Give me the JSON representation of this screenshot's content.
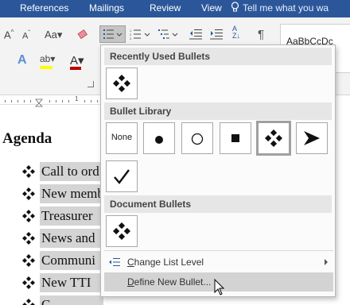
{
  "ribbon_tabs": [
    "References",
    "Mailings",
    "Review",
    "View"
  ],
  "tell_me": "Tell me what you wa",
  "styles_preview": "AaBbCcDc",
  "ruler_number": "1",
  "document": {
    "heading": "Agenda",
    "items": [
      "Call to ord",
      "New memb",
      "Treasurer",
      "News and",
      "Communi",
      "New TTI",
      "C"
    ]
  },
  "bullets_menu": {
    "recent_header": "Recently Used Bullets",
    "library_header": "Bullet Library",
    "document_header": "Document Bullets",
    "none_label": "None",
    "library_icons": [
      "none-icon",
      "filled-circle-icon",
      "hollow-circle-icon",
      "filled-square-icon",
      "four-diamond-icon",
      "arrowhead-icon",
      "checkmark-icon"
    ],
    "change_level_prefix": "C",
    "change_level_rest": "hange List Level",
    "define_prefix": "D",
    "define_rest": "efine New Bullet..."
  },
  "colors": {
    "tab_bar": "#2b579a",
    "selection": "#d4d4d4",
    "font_color_bar": "#c00000",
    "highlight_bar": "#ffff00"
  }
}
